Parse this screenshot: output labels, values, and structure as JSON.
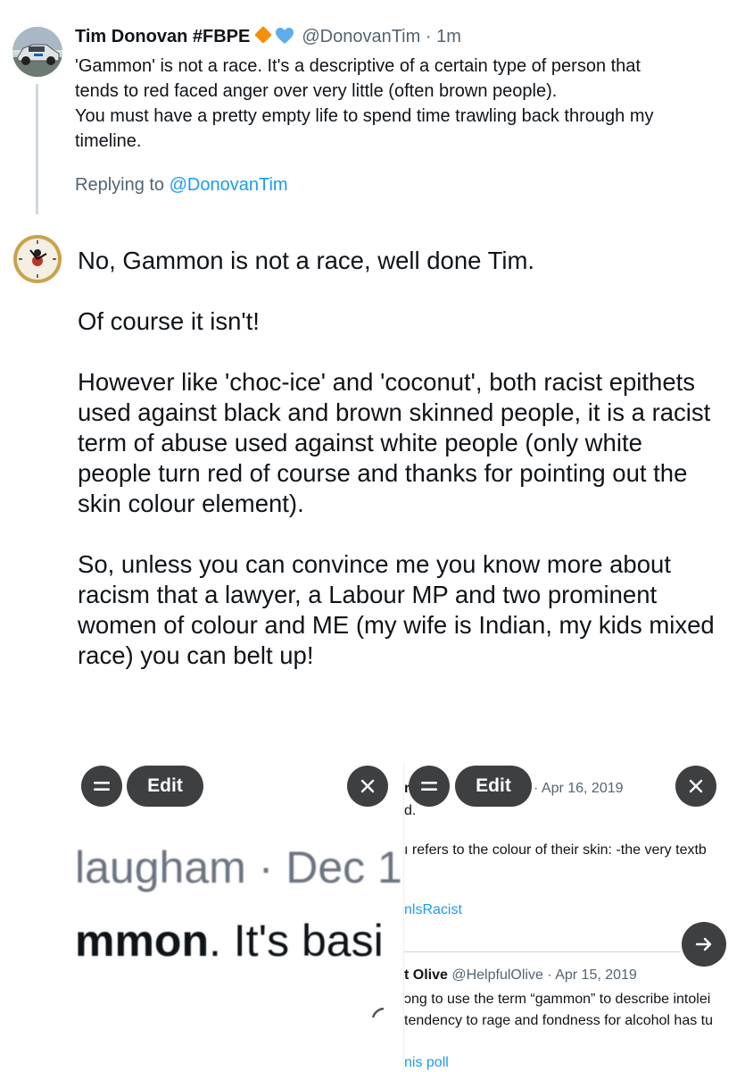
{
  "tweet_parent": {
    "display_name": "Tim Donovan #FBPE",
    "handle": "@DonovanTim",
    "separator": "·",
    "time": "1m",
    "text_lines": [
      "'Gammon' is not a race. It's a descriptive of a certain type of person that",
      "tends to red faced anger over very little (often brown people).",
      "You must have a pretty empty life to spend time trawling back through my",
      "timeline."
    ],
    "replying_to_label": "Replying to",
    "replying_to_handle": "@DonovanTim",
    "avatar_icon": "car-avatar-icon",
    "badge_colors": {
      "diamond": "#f4900c",
      "heart": "#5dadec"
    }
  },
  "tweet_main": {
    "avatar_icon": "clock-avatar-icon",
    "paragraphs": [
      "No, Gammon is not a race, well done Tim.",
      "Of course it isn't!",
      "However like 'choc-ice' and 'coconut', both racist epithets used against black and brown skinned people, it is a racist term of abuse used against white people (only white people turn red of course and thanks for pointing out the skin colour element).",
      "So, unless you can convince me you know more about racism that a lawyer, a Labour MP and two prominent women of colour and ME (my wife is Indian, my kids mixed race) you can belt up!"
    ]
  },
  "toolbars": [
    {
      "menu_icon": "equals-icon",
      "edit_label": "Edit",
      "close_icon": "close-icon"
    },
    {
      "menu_icon": "equals-icon",
      "edit_label": "Edit",
      "close_icon": "close-icon"
    }
  ],
  "fragment_left": {
    "handle_text": "laugham · Dec 1",
    "body_bold": "mmon",
    "body_rest": ". It's basi"
  },
  "fragment_right": {
    "line1_name": "r",
    "line1_date": "· Apr 16, 2019",
    "line2": "d.",
    "line3": "ı refers to the colour of their skin: -the very textb",
    "line4_link": "nlsRacist",
    "line5_name": "t Olive",
    "line5_handle": "@HelpfulOlive",
    "line5_date": "· Apr 15, 2019",
    "line6": "ɔng to use the term “gammon” to describe intolei",
    "line7": "tendency to rage and fondness for alcohol has tu",
    "line8_link": "nis poll",
    "arrow_icon": "arrow-right-icon"
  }
}
